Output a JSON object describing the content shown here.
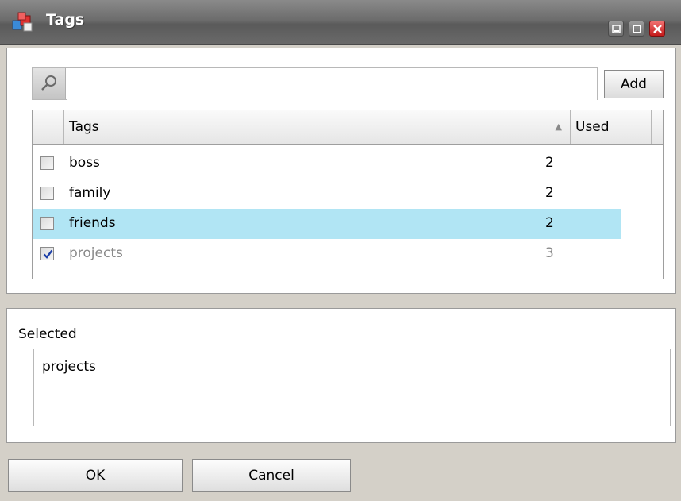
{
  "window": {
    "title": "Tags",
    "app_icon": "colored-cubes-icon",
    "controls": [
      "minimize-icon",
      "maximize-icon",
      "close-icon"
    ]
  },
  "search": {
    "value": "",
    "icon": "search-icon",
    "add_label": "Add"
  },
  "grid": {
    "columns": {
      "tags": "Tags",
      "used": "Used",
      "sort": "ascending"
    },
    "rows": [
      {
        "name": "boss",
        "used": "2",
        "checked": false,
        "selected": false
      },
      {
        "name": "family",
        "used": "2",
        "checked": false,
        "selected": false
      },
      {
        "name": "friends",
        "used": "2",
        "checked": false,
        "selected": true
      },
      {
        "name": "projects",
        "used": "3",
        "checked": true,
        "selected": false
      }
    ]
  },
  "selected_panel": {
    "label": "Selected",
    "value": "projects"
  },
  "buttons": {
    "ok": "OK",
    "cancel": "Cancel"
  },
  "colors": {
    "selection": "#b1e5f4",
    "titlebar": "#6c6c6c",
    "close": "#d02020"
  }
}
